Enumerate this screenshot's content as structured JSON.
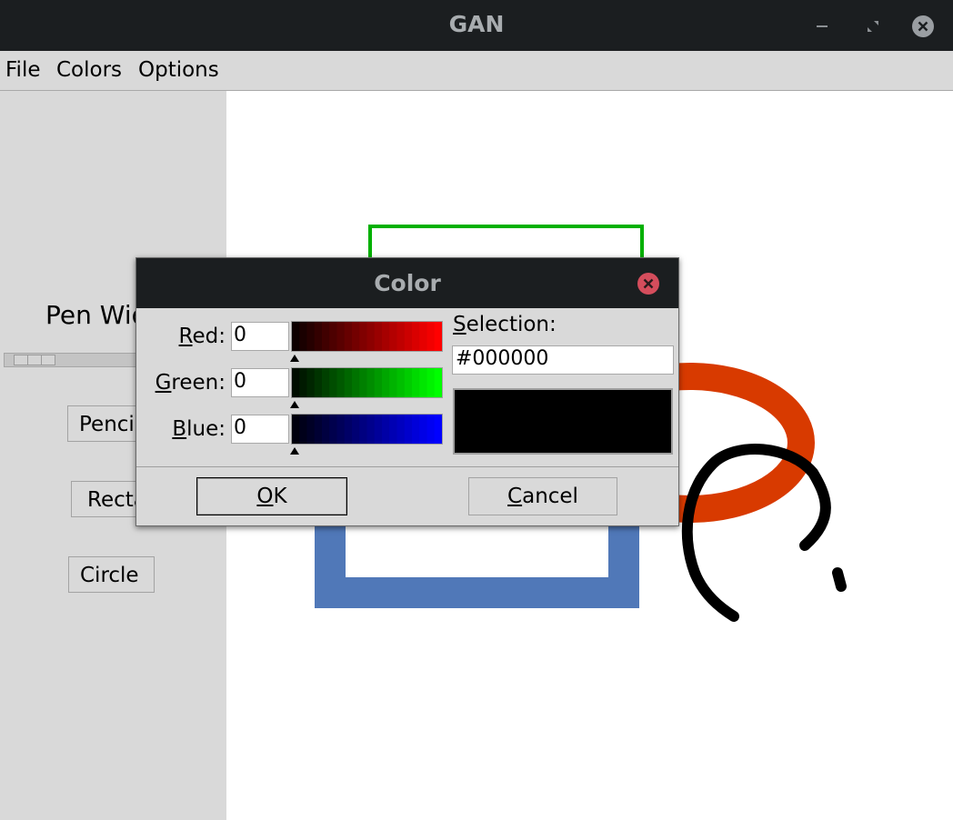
{
  "window": {
    "title": "GAN"
  },
  "menubar": {
    "items": [
      "File",
      "Colors",
      "Options"
    ]
  },
  "toolpanel": {
    "pen_width_label": "Pen Width",
    "pen_width_level": 0.1,
    "pencil_label": "Pencil",
    "rect_label": "Rectangle",
    "circle_label": "Circle"
  },
  "canvas": {
    "shapes": [
      {
        "kind": "rectangle-outline",
        "color": "#00b000"
      },
      {
        "kind": "rectangle-outline",
        "color": "#5078b8"
      },
      {
        "kind": "ellipse-outline",
        "color": "#d83a00"
      },
      {
        "kind": "freehand-stroke",
        "color": "#000000"
      }
    ]
  },
  "dialog": {
    "title": "Color",
    "red": {
      "mnemonic": "R",
      "rest": "ed:",
      "value": "0"
    },
    "green": {
      "mnemonic": "G",
      "rest": "reen:",
      "value": "0"
    },
    "blue": {
      "mnemonic": "B",
      "rest": "lue:",
      "value": "0"
    },
    "selection": {
      "mnemonic": "S",
      "rest": "election:",
      "value": "#000000"
    },
    "ok": {
      "mnemonic": "O",
      "rest": "K"
    },
    "cancel": {
      "mnemonic": "C",
      "rest": "ancel"
    },
    "swatch_color": "#000000"
  },
  "icons": {
    "minimize": "minimize-icon",
    "maximize": "restore-icon",
    "close": "close-icon"
  }
}
